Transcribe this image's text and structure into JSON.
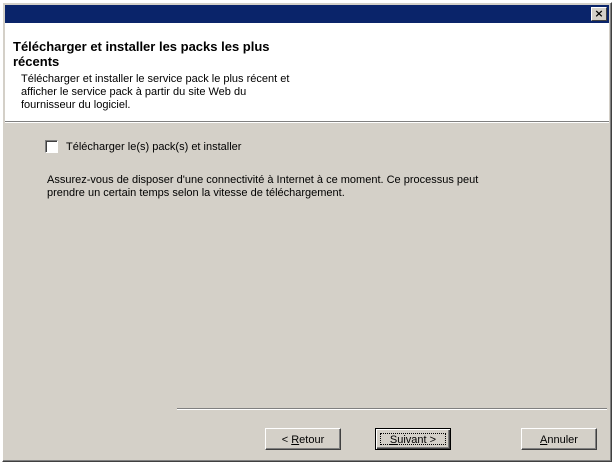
{
  "dialog": {
    "close_symbol": "×",
    "close_icon": "close-icon"
  },
  "header": {
    "title_line1": "Télécharger et installer les packs les plus",
    "title_line2": "récents",
    "subtitle_line1": "Télécharger et installer le service pack le plus récent et",
    "subtitle_line2": "afficher le service pack à partir du site Web du",
    "subtitle_line3": "fournisseur du logiciel."
  },
  "options": {
    "download_checkbox_label": "Télécharger le(s) pack(s) et installer",
    "download_checkbox_checked": false
  },
  "info": {
    "line1": "Assurez-vous de disposer d'une connectivité à Internet  à ce moment. Ce processus peut",
    "line2": "prendre un certain temps selon la vitesse de téléchargement."
  },
  "buttons": {
    "back_prefix": "< ",
    "back_mnemonic": "R",
    "back_rest": "etour",
    "next_mnemonic": "S",
    "next_rest": "uivant >",
    "cancel_mnemonic": "A",
    "cancel_rest": "nnuler"
  },
  "colors": {
    "titlebar": "#0a246a",
    "dialog_face": "#d4d0c8",
    "header_background": "#ffffff"
  }
}
